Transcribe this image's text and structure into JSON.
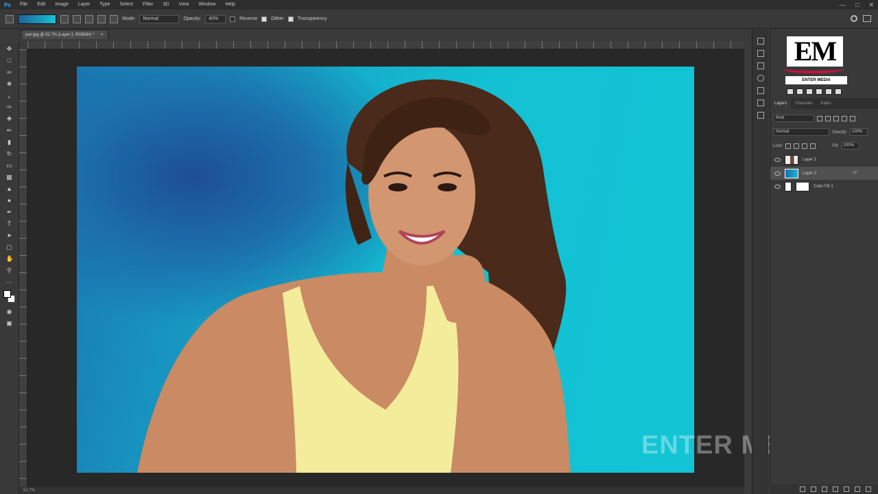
{
  "app": {
    "logo": "Ps"
  },
  "menu": [
    "File",
    "Edit",
    "Image",
    "Layer",
    "Type",
    "Select",
    "Filter",
    "3D",
    "View",
    "Window",
    "Help"
  ],
  "options": {
    "mode_label": "Mode:",
    "mode_value": "Normal",
    "opacity_label": "Opacity:",
    "opacity_value": "40%",
    "reverse_label": "Reverse",
    "dither_label": "Dither",
    "transparency_label": "Transparency",
    "gradient_colors": [
      "#1f5f9a",
      "#17c4d3"
    ]
  },
  "document": {
    "tab_label": "pari.jpg @ 52.7% (Layer 2, RGB/8#) *",
    "close": "×"
  },
  "status": {
    "zoom": "52.7%"
  },
  "watermark": "ENTER MEDIA",
  "logo": {
    "letters": "EM",
    "subtitle": "ENTER MEDIA"
  },
  "panel": {
    "tabs": [
      "Layers",
      "Channels",
      "Paths"
    ],
    "filter_label": "Kind",
    "blend_mode": "Normal",
    "opacity_label": "Opacity:",
    "opacity_value": "100%",
    "lock_label": "Lock:",
    "fill_label": "Fill:",
    "fill_value": "100%",
    "layers": [
      {
        "name": "Layer 1"
      },
      {
        "name": "Layer 2"
      },
      {
        "name": "Color Fill 1"
      }
    ]
  },
  "colors": {
    "canvas_light": "#13c1d3",
    "canvas_dark": "#1d4f93",
    "accent": "#31a8ff"
  }
}
